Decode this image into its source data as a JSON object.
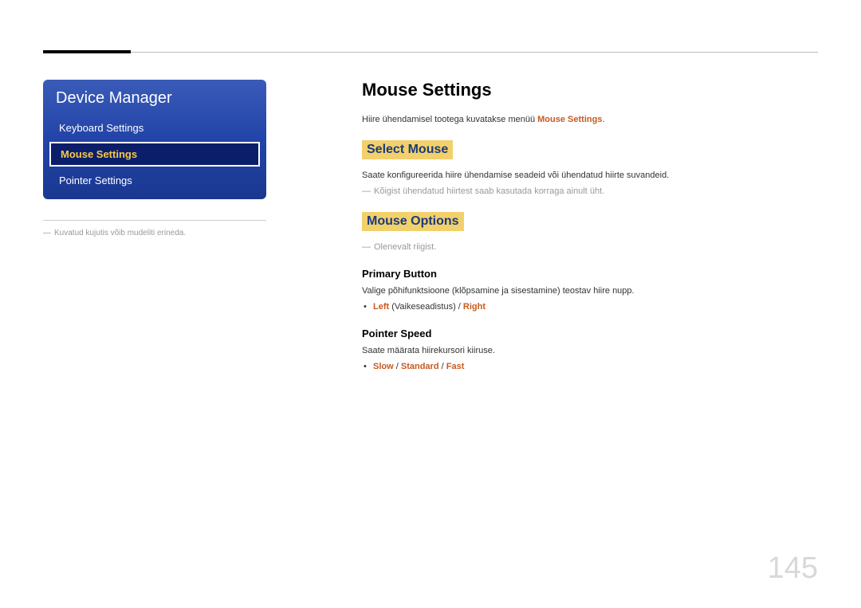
{
  "sidebar": {
    "title": "Device Manager",
    "items": [
      {
        "label": "Keyboard Settings",
        "active": false
      },
      {
        "label": "Mouse Settings",
        "active": true
      },
      {
        "label": "Pointer Settings",
        "active": false
      }
    ],
    "caption": "Kuvatud kujutis võib mudeliti erineda."
  },
  "main": {
    "heading": "Mouse Settings",
    "intro_prefix": "Hiire ühendamisel tootega kuvatakse menüü ",
    "intro_term": "Mouse Settings",
    "intro_suffix": ".",
    "section1": {
      "title": "Select Mouse",
      "text": "Saate konfigureerida hiire ühendamise seadeid või ühendatud hiirte suvandeid.",
      "note": "Kõigist ühendatud hiirtest saab kasutada korraga ainult üht."
    },
    "section2": {
      "title": "Mouse Options",
      "note": "Olenevalt riigist.",
      "sub1": {
        "heading": "Primary Button",
        "text": "Valige põhifunktsioone (klõpsamine ja sisestamine) teostav hiire nupp.",
        "options": [
          "Left",
          "Right"
        ],
        "default_note": "(Vaikeseadistus)"
      },
      "sub2": {
        "heading": "Pointer Speed",
        "text": "Saate määrata hiirekursori kiiruse.",
        "options": [
          "Slow",
          "Standard",
          "Fast"
        ]
      }
    }
  },
  "page_number": "145"
}
